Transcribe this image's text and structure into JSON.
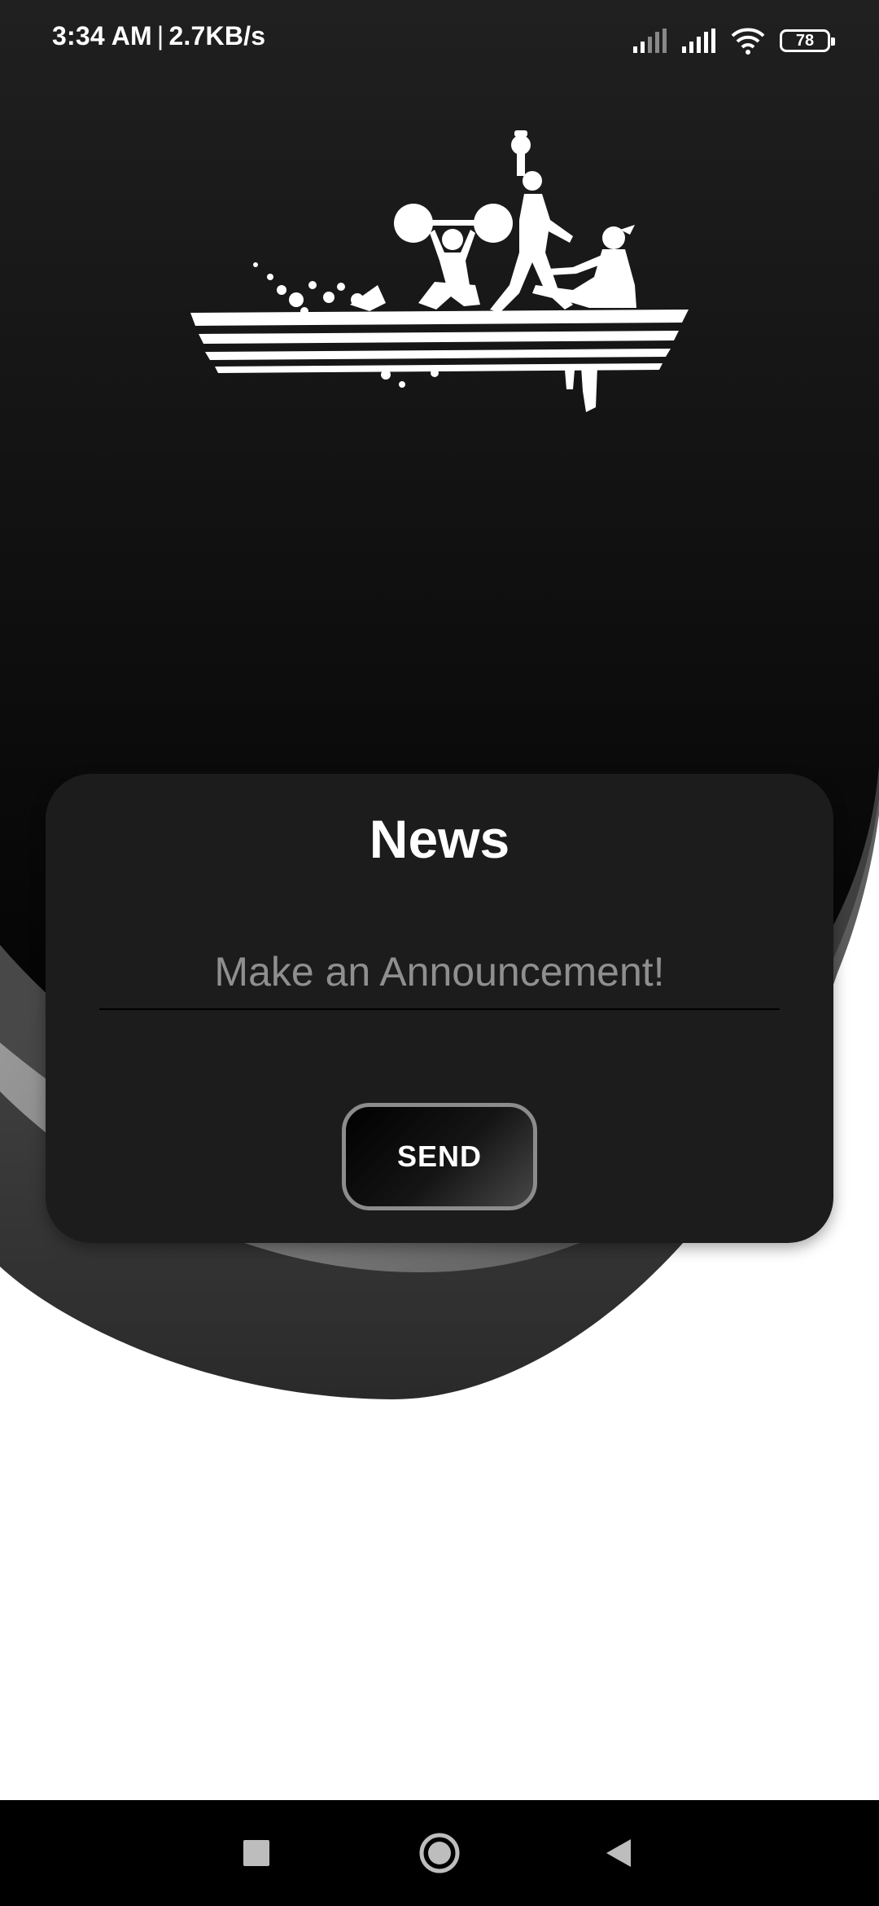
{
  "status_bar": {
    "time": "3:34 AM",
    "separator": "|",
    "net_speed": "2.7KB/s",
    "battery_level": "78",
    "icons": [
      "signal-icon",
      "signal-icon",
      "wifi-icon",
      "battery-icon"
    ]
  },
  "logo": {
    "icon": "fitness-athletes-logo"
  },
  "card": {
    "title": "News",
    "input_placeholder": "Make an Announcement!",
    "input_value": "",
    "send_label": "SEND"
  },
  "nav_bar": {
    "icons": [
      "recents-square-icon",
      "home-circle-icon",
      "back-triangle-icon"
    ]
  },
  "colors": {
    "background_top": "#000000",
    "card": "#1c1c1c",
    "page": "#ffffff",
    "text": "#ffffff",
    "placeholder": "#8f8f8f"
  }
}
